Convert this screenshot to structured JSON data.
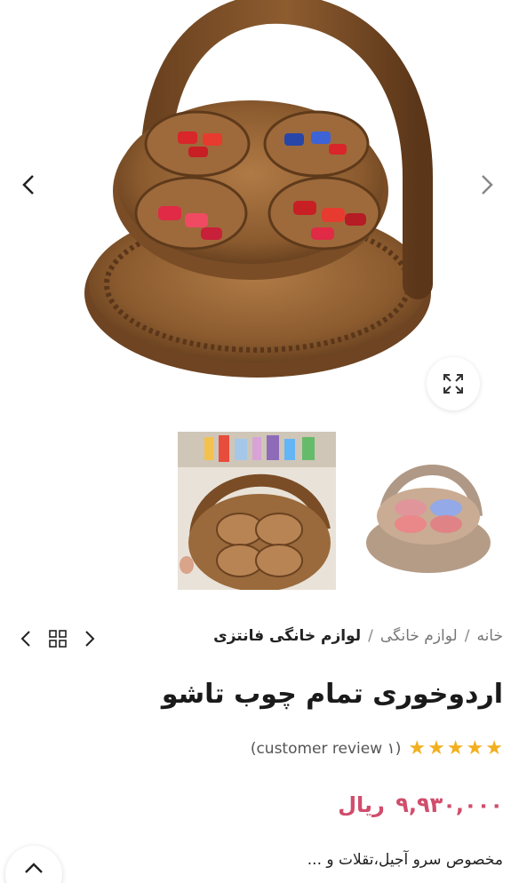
{
  "gallery": {
    "main_image_alt": "basket",
    "thumbnails": [
      "thumb-hand",
      "thumb-basket"
    ]
  },
  "breadcrumb": {
    "home": "خانه",
    "category": "لوازم خانگی",
    "current": "لوازم خانگی فانتزی",
    "separator": "/"
  },
  "product": {
    "title": "اردوخوری تمام چوب تاشو",
    "rating_stars": 5,
    "review_text": "(۱ customer review)",
    "price": "۹,۹۳۰,۰۰۰",
    "currency": "ریال",
    "description": "مخصوص سرو آجیل،تقلات و ..."
  },
  "colors": {
    "accent_price": "#d04d6b",
    "star": "#f2b01e"
  }
}
